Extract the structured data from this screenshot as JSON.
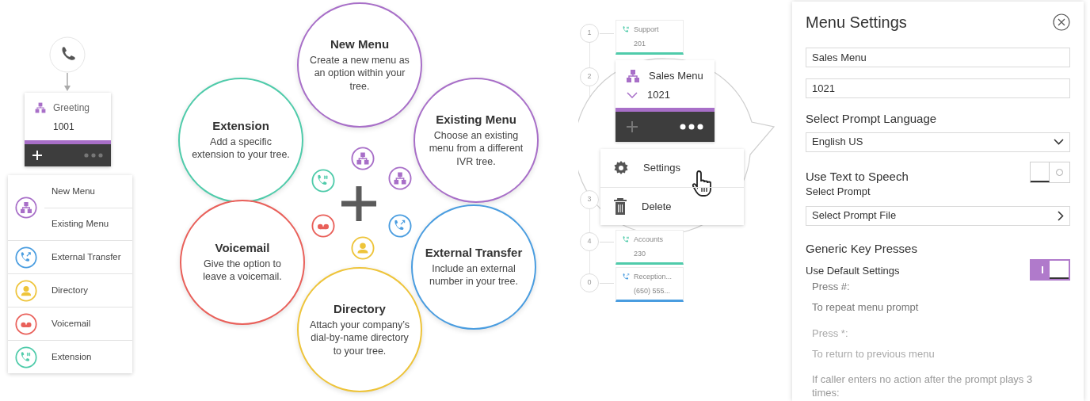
{
  "start_node": {
    "title": "Greeting",
    "number": "1001"
  },
  "add_menu": [
    {
      "kind": "menu",
      "color": "#a86fc8",
      "labels": [
        "New Menu",
        "Existing Menu"
      ]
    },
    {
      "kind": "transfer",
      "color": "#4a9de0",
      "labels": [
        "External Transfer"
      ]
    },
    {
      "kind": "directory",
      "color": "#eec43a",
      "labels": [
        "Directory"
      ]
    },
    {
      "kind": "voicemail",
      "color": "#e9605a",
      "labels": [
        "Voicemail"
      ]
    },
    {
      "kind": "extension",
      "color": "#4fcbaa",
      "labels": [
        "Extension"
      ]
    }
  ],
  "options": [
    {
      "kind": "menu",
      "color": "#a86fc8",
      "title": "New Menu",
      "description": "Create a new menu as an option within your tree."
    },
    {
      "kind": "extension",
      "color": "#4fcbaa",
      "title": "Extension",
      "description": "Add a specific extension to your tree."
    },
    {
      "kind": "menu",
      "color": "#a86fc8",
      "title": "Existing Menu",
      "description": "Choose an existing menu from a different IVR tree."
    },
    {
      "kind": "voicemail",
      "color": "#e9605a",
      "title": "Voicemail",
      "description": "Give the option to leave a voicemail."
    },
    {
      "kind": "transfer",
      "color": "#4a9de0",
      "title": "External Transfer",
      "description": "Include an external number in your tree."
    },
    {
      "kind": "directory",
      "color": "#eec43a",
      "title": "Directory",
      "description": "Attach your company’s dial-by-name directory to your tree."
    }
  ],
  "tree": {
    "keys": [
      {
        "key": "1",
        "card": {
          "kind": "extension",
          "color": "#4fcbaa",
          "title": "Support",
          "number": "201"
        }
      },
      {
        "key": "2"
      },
      {
        "key": "3"
      },
      {
        "key": "4",
        "card": {
          "kind": "extension",
          "color": "#4fcbaa",
          "title": "Accounts",
          "number": "230"
        }
      },
      {
        "key": "0",
        "card": {
          "kind": "transfer",
          "color": "#4a9de0",
          "title": "Reception...",
          "number": "(650) 555..."
        }
      }
    ],
    "selected_node": {
      "title": "Sales Menu",
      "number": "1021"
    },
    "context_menu": [
      {
        "kind": "settings",
        "label": "Settings",
        "hovered": true
      },
      {
        "kind": "delete",
        "label": "Delete",
        "hovered": false
      }
    ]
  },
  "menu_settings": {
    "title": "Menu Settings",
    "name": "Sales Menu",
    "number": "1021",
    "language_label": "Select Prompt Language",
    "language": "English US",
    "tts_label": "Use Text to Speech",
    "tts_on": false,
    "prompt_label": "Select Prompt",
    "prompt_file": "Select Prompt File",
    "key_presses_heading": "Generic Key Presses",
    "default_label": "Use Default Settings",
    "default_on": true,
    "key_presses": [
      {
        "key": "Press #:",
        "action": "To repeat menu prompt"
      },
      {
        "key": "Press *:",
        "action": "To return to previous menu"
      }
    ],
    "no_action_note": "If caller enters no action after the prompt plays 3 times:"
  }
}
